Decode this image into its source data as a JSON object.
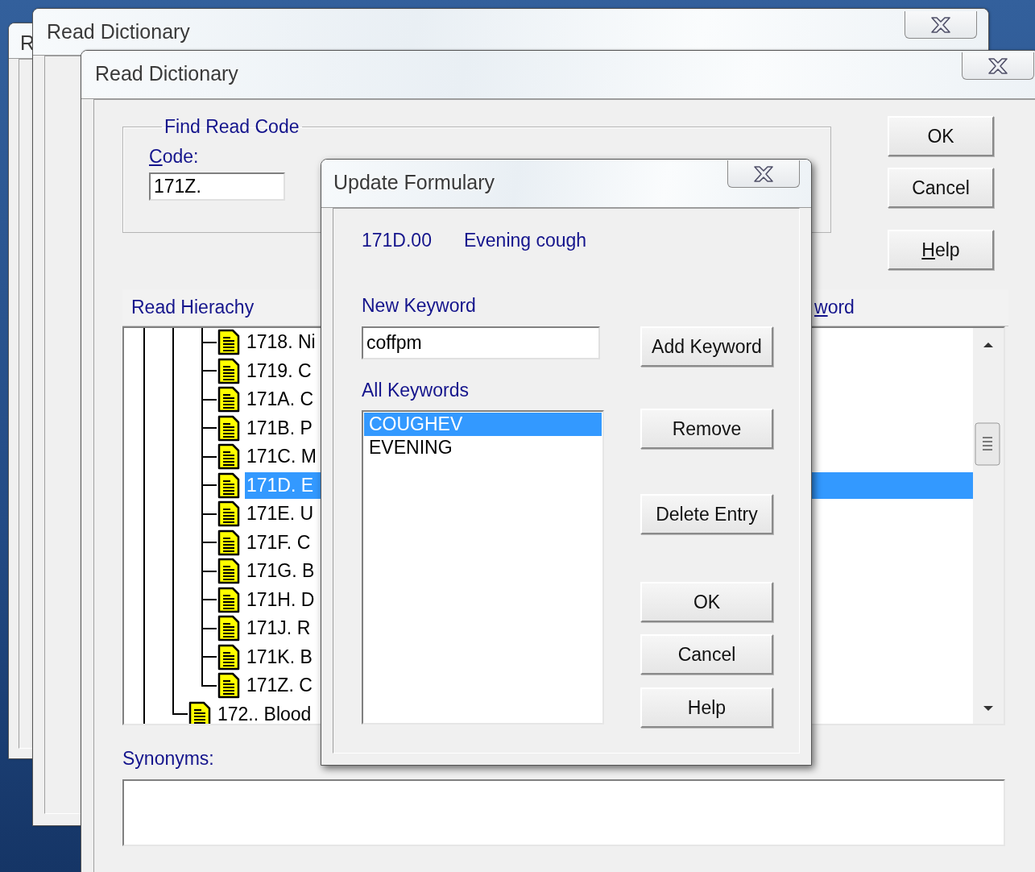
{
  "background_window": {
    "title": "R"
  },
  "middle_window": {
    "title": "Read Dictionary"
  },
  "main_window": {
    "title": "Read Dictionary",
    "find_group": {
      "legend": "Find Read Code",
      "code_label": {
        "text": "Code:",
        "accelerator": true
      },
      "code_value": "171Z."
    },
    "buttons": [
      {
        "label": "OK",
        "accelerator": false
      },
      {
        "label": "Cancel",
        "accelerator": false
      },
      {
        "label": "Help",
        "accelerator": true
      }
    ],
    "hierarchy": {
      "columns": [
        {
          "label": "Read Hierachy",
          "accelerator": false
        },
        {
          "label": "word",
          "accelerator": true
        }
      ],
      "items": [
        {
          "children": [
            {
              "label": "1718. Ni",
              "selected": false
            },
            {
              "label": "1719. C",
              "selected": false
            },
            {
              "label": "171A. C",
              "selected": false
            },
            {
              "label": "171B. P",
              "selected": false
            },
            {
              "label": "171C. M",
              "selected": false
            },
            {
              "label": "171D. E",
              "selected": true
            },
            {
              "label": "171E. U",
              "selected": false
            },
            {
              "label": "171F. C",
              "selected": false
            },
            {
              "label": "171G. B",
              "selected": false
            },
            {
              "label": "171H. D",
              "selected": false
            },
            {
              "label": "171J. R",
              "selected": false
            },
            {
              "label": "171K. B",
              "selected": false
            },
            {
              "label": "171Z. C",
              "selected": false
            }
          ]
        },
        {
          "label": "172.. Blood",
          "selected": false
        }
      ]
    },
    "synonyms": {
      "label": "Synonyms:"
    }
  },
  "formulary_dialog": {
    "title": "Update Formulary",
    "code": "171D.00",
    "term": "Evening cough",
    "new_keyword": {
      "label": "New Keyword",
      "value": "coffpm"
    },
    "all_keywords": {
      "label": "All Keywords",
      "items": [
        {
          "label": "COUGHEV",
          "selected": true
        },
        {
          "label": "EVENING",
          "selected": false
        }
      ]
    },
    "buttons": [
      {
        "label": "Add Keyword"
      },
      {
        "label": "Remove"
      },
      {
        "label": "Delete Entry"
      },
      {
        "label": "OK"
      },
      {
        "label": "Cancel"
      },
      {
        "label": "Help"
      }
    ]
  }
}
